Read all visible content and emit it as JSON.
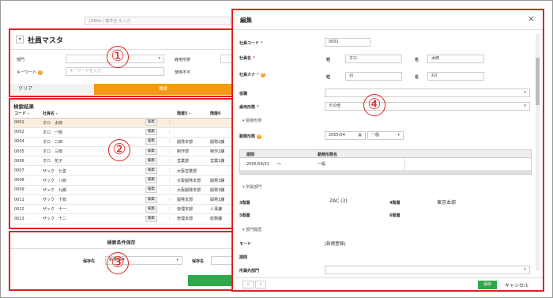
{
  "top_search": {
    "placeholder": "JOBNo / 案件名 を入力"
  },
  "employee_master": {
    "title": "社員マスタ",
    "labels": {
      "department": "部門",
      "keyword": "キーワード",
      "employment_type": "雇用形態",
      "unavailable": "使用不可"
    },
    "keyword_placeholder": "キーワードを入力",
    "clear_label": "クリア",
    "search_label": "検索"
  },
  "results": {
    "title": "検索結果",
    "columns": [
      "コード",
      "社員名",
      "",
      "",
      "階層5",
      "階層6"
    ],
    "edit_label": "編集",
    "rows": [
      {
        "code": "0001",
        "name": "オロ　太郎",
        "h5": "",
        "h6": ""
      },
      {
        "code": "0002",
        "name": "オロ　一郎",
        "h5": "",
        "h6": ""
      },
      {
        "code": "0004",
        "name": "オロ　二郎",
        "h5": "開発本部",
        "h6": "開発2課"
      },
      {
        "code": "0005",
        "name": "オロ　三郎",
        "h5": "制作部",
        "h6": "制作2課"
      },
      {
        "code": "0006",
        "name": "オロ　花子",
        "h5": "営業部",
        "h6": "営業1課"
      },
      {
        "code": "0007",
        "name": "ザック　七善",
        "h5": "大阪営業部",
        "h6": ""
      },
      {
        "code": "0008",
        "name": "ザック　八郎",
        "h5": "大阪開発本部",
        "h6": "開発3課"
      },
      {
        "code": "0009",
        "name": "ザック　九朗",
        "h5": "大阪開発本部",
        "h6": "開発3課"
      },
      {
        "code": "0011",
        "name": "ザック　十郎",
        "h5": "開発本部",
        "h6": "開発1課"
      },
      {
        "code": "0012",
        "name": "ザック　十一",
        "h5": "管理本部",
        "h6": "人事課"
      },
      {
        "code": "0013",
        "name": "ザック　十二",
        "h5": "管理本部",
        "h6": "総務課"
      }
    ]
  },
  "save_conditions": {
    "title": "検索条件保存",
    "save_to_label": "保存先",
    "save_to_value": "新規保存",
    "save_name_label": "保存名"
  },
  "edit_modal": {
    "title": "編集",
    "close": "×",
    "employee_code_label": "社員コード",
    "employee_code": "0001",
    "employee_name_label": "社員名",
    "surname_label": "姓",
    "given_label": "名",
    "surname": "オロ",
    "given": "太郎",
    "kana_label": "社員カナ",
    "kana_surname": "ｵﾛ",
    "kana_given": "ﾀﾛｳ",
    "position_label": "役職",
    "employment_label": "雇用形態",
    "employment_value": "その他",
    "work_section": "勤務形態",
    "work_type_label": "勤務形態",
    "work_month": "2005/04",
    "work_type_value": "一般",
    "period_header": "期間",
    "work_name_header": "勤務形態名",
    "period_value": "2005/04/01　　〜",
    "period_type": "一般",
    "dept_section": "所属部門",
    "level3_label": "3階層",
    "level3_value": "ZAC (3)",
    "level4_label": "4階層",
    "level4_value": "東京本部",
    "level5_label": "5階層",
    "level6_label": "6階層",
    "dept_history_section": "部門履歴",
    "mode_label": "モード",
    "mode_value": "[新規登録]",
    "period_label": "期間",
    "affiliation_label": "所属先部門",
    "save_label": "保存",
    "cancel_label": "キャンセル"
  },
  "annotations": [
    "①",
    "②",
    "③",
    "④"
  ]
}
